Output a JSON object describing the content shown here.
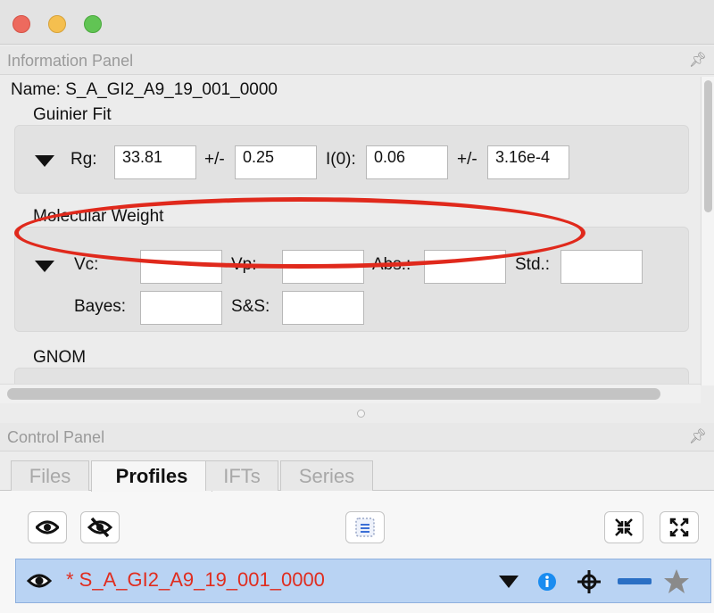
{
  "window": {
    "title": ""
  },
  "info_panel": {
    "header": "Information Panel",
    "name_label": "Name:",
    "name_value": "S_A_GI2_A9_19_001_0000",
    "guinier": {
      "title": "Guinier Fit",
      "rg_label": "Rg:",
      "rg_value": "33.81",
      "rg_err_label": "+/-",
      "rg_err_value": "0.25",
      "i0_label": "I(0):",
      "i0_value": "0.06",
      "i0_err_label": "+/-",
      "i0_err_value": "3.16e-4"
    },
    "mw": {
      "title": "Molecular Weight",
      "vc_label": "Vc:",
      "vp_label": "Vp:",
      "abs_label": "Abs.:",
      "std_label": "Std.:",
      "bayes_label": "Bayes:",
      "ss_label": "S&S:",
      "vc_value": "",
      "vp_value": "",
      "abs_value": "",
      "std_value": "",
      "bayes_value": "",
      "ss_value": ""
    },
    "gnom": {
      "title": "GNOM"
    }
  },
  "control_panel": {
    "header": "Control Panel",
    "tabs": [
      {
        "label": "Files",
        "active": false
      },
      {
        "label": "Profiles",
        "active": true
      },
      {
        "label": "IFTs",
        "active": false
      },
      {
        "label": "Series",
        "active": false
      }
    ],
    "profile": {
      "name": "* S_A_GI2_A9_19_001_0000"
    }
  },
  "colors": {
    "highlight_oval": "#e0291c",
    "profile_name": "#e02d1f",
    "row_selected": "#b9d3f3",
    "info_icon": "#1a8cf0",
    "line_icon": "#2a6fc4",
    "star_icon": "#8a8a8a"
  },
  "icons": {
    "show_all": "eye-icon",
    "hide_all": "eye-slash-icon",
    "select_all": "list-icon",
    "collapse_all": "collapse-icon",
    "expand_all": "expand-icon",
    "row_visible": "eye-icon",
    "row_menu": "triangle-down-icon",
    "row_info": "info-icon",
    "row_locate": "crosshair-icon",
    "row_line": "line-style-icon",
    "row_star": "star-icon"
  }
}
